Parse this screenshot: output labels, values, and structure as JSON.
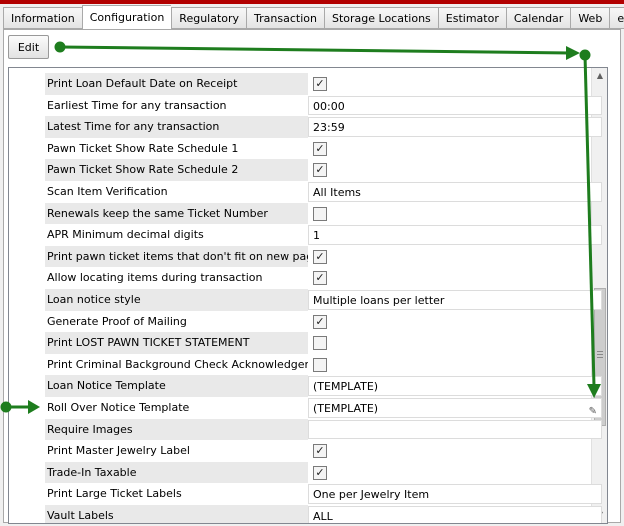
{
  "tabs": [
    "Information",
    "Configuration",
    "Regulatory",
    "Transaction",
    "Storage Locations",
    "Estimator",
    "Calendar",
    "Web",
    "eBay"
  ],
  "active_tab": "Configuration",
  "toolbar": {
    "edit_label": "Edit"
  },
  "settings": [
    {
      "label": "Print Loan Default Date on Receipt",
      "type": "checkbox",
      "checked": true
    },
    {
      "label": "Earliest Time for any transaction",
      "type": "text",
      "value": "00:00"
    },
    {
      "label": "Latest Time for any transaction",
      "type": "text",
      "value": "23:59"
    },
    {
      "label": "Pawn Ticket Show Rate Schedule 1",
      "type": "checkbox",
      "checked": true
    },
    {
      "label": "Pawn Ticket Show Rate Schedule 2",
      "type": "checkbox",
      "checked": true
    },
    {
      "label": "Scan Item Verification",
      "type": "text",
      "value": "All Items"
    },
    {
      "label": "Renewals keep the same Ticket Number",
      "type": "checkbox",
      "checked": false
    },
    {
      "label": "APR Minimum decimal digits",
      "type": "text",
      "value": "1"
    },
    {
      "label": "Print pawn ticket items that don't fit on new page",
      "type": "checkbox",
      "checked": true
    },
    {
      "label": "Allow locating items during transaction",
      "type": "checkbox",
      "checked": true
    },
    {
      "label": "Loan notice style",
      "type": "text",
      "value": "Multiple loans per letter"
    },
    {
      "label": "Generate Proof of Mailing",
      "type": "checkbox",
      "checked": true
    },
    {
      "label": "Print LOST PAWN TICKET STATEMENT",
      "type": "checkbox",
      "checked": false
    },
    {
      "label": "Print Criminal Background Check Acknowledgement",
      "type": "checkbox",
      "checked": false
    },
    {
      "label": "Loan Notice Template",
      "type": "text",
      "value": "(TEMPLATE)"
    },
    {
      "label": "Roll Over Notice Template",
      "type": "text",
      "value": "(TEMPLATE)",
      "pencil": true
    },
    {
      "label": "Require Images",
      "type": "text",
      "value": ""
    },
    {
      "label": "Print Master Jewelry Label",
      "type": "checkbox",
      "checked": true
    },
    {
      "label": "Trade-In Taxable",
      "type": "checkbox",
      "checked": true
    },
    {
      "label": "Print Large Ticket Labels",
      "type": "text",
      "value": "One per Jewelry Item"
    },
    {
      "label": "Vault Labels",
      "type": "text",
      "value": "ALL"
    }
  ],
  "colors": {
    "annotation_arrow": "#1e7d1e",
    "title_strip": "#b20000"
  },
  "icons": {
    "checkbox_check": "check-icon",
    "edit_pencil": "pencil-icon",
    "scroll_up": "scroll-up-icon",
    "scroll_down": "scroll-down-icon"
  }
}
